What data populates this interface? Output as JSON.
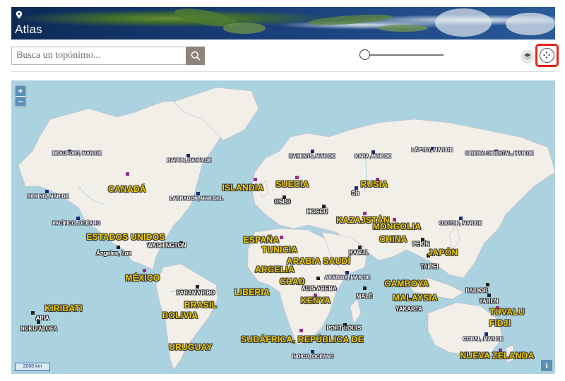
{
  "header": {
    "title": "Atlas"
  },
  "search": {
    "placeholder": "Busca un topónimo..."
  },
  "map": {
    "scale_label": "2000 km",
    "zoom_in": "+",
    "zoom_out": "−",
    "info": "i",
    "countries": [
      "CANADÁ",
      "ISLANDIA",
      "SUECIA",
      "RUSIA",
      "ESTADOS UNIDOS",
      "KAZAJSTÁN",
      "MONGOLIA",
      "ESPAÑA",
      "TUNICIA",
      "CHINA",
      "JAPÓN",
      "ARGELIA",
      "ARABIA SAUDÍ",
      "MÉXICO",
      "CHAD",
      "LIBERIA",
      "CAMBOYA",
      "KENYA",
      "MALAYSIA",
      "BRASIL",
      "KIRIBATI",
      "BOLIVIA",
      "TUVALU",
      "FIDJI",
      "SUDÁFRICA, REPÚBLICA DE",
      "URUGUAY",
      "NUEVA ZELANDA"
    ],
    "seas": [
      "BEAUFORT, MAR DE",
      "BAFFIN, BAHÍA DE",
      "BARENTS, MAR DE",
      "KARA, MAR DE",
      "LÁPTEY, MAR DE",
      "SIBERIA ORIENTAL, MAR DE",
      "BERING, MAR DE",
      "LABRADOR, MAR DEL",
      "PACÍFICO, OCÉANO",
      "OJOTSK, MAR DE",
      "ARÁBIGA, MAR DE",
      "CORAL, MAR DE",
      "ÍNDICO, OCÉANO"
    ],
    "cities": [
      "OSLO",
      "MOSCÚ",
      "Ob",
      "Ángeles, Los",
      "WASHINGTON",
      "KABUL",
      "PEKÍN",
      "TAIPEI",
      "ADIS ABEBA",
      "MALÉ",
      "PARAMARIBO",
      "YAKARTA",
      "PALIKIR",
      "YAREN",
      "APIA",
      "NUKU'ALOFA",
      "PORT LOUIS"
    ]
  },
  "colors": {
    "accent": "#e8201b",
    "search_button": "#8f8378",
    "water": "#aad3df",
    "land": "#f2efe9"
  }
}
